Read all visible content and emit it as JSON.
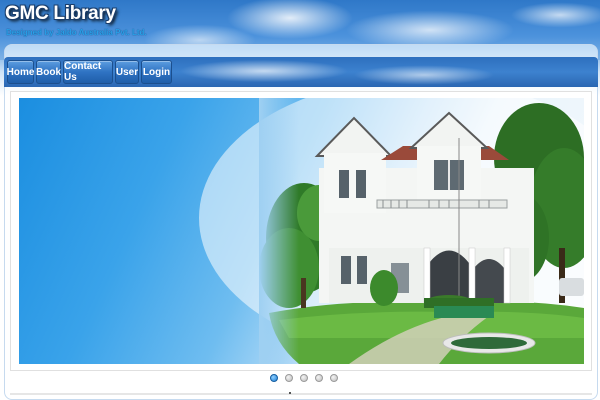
{
  "header": {
    "title": "GMC Library",
    "subtitle": "Designed by Jaldo Australia Pvt. Ltd."
  },
  "nav": {
    "items": [
      {
        "label": "Home"
      },
      {
        "label": "Book"
      },
      {
        "label": "Contact Us"
      },
      {
        "label": "User"
      },
      {
        "label": "Login"
      }
    ]
  },
  "slider": {
    "slide_count": 5,
    "active_index": 0,
    "image_subject": "colonial-style white library building with lawn and trees"
  },
  "colors": {
    "header_blue": "#2f78c8",
    "nav_button": "#2f73c3",
    "title_text": "#ffffff",
    "subtitle_text": "#29a0e8",
    "active_dot": "#1f7fd6"
  },
  "icons": {
    "pager": "dot-icon"
  }
}
